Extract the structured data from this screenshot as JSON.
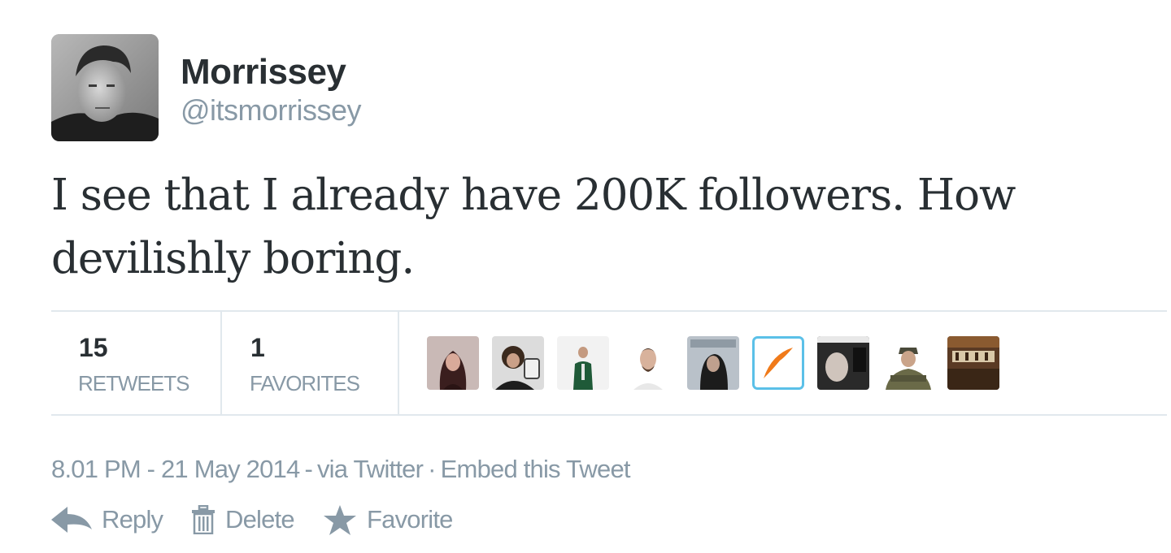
{
  "author": {
    "display_name": "Morrissey",
    "screen_name": "@itsmorrissey"
  },
  "tweet": {
    "text": "I see that I already have 200K followers. How devilishly boring."
  },
  "stats": {
    "retweets": {
      "count": "15",
      "label": "RETWEETS"
    },
    "favorites": {
      "count": "1",
      "label": "FAVORITES"
    }
  },
  "meta": {
    "timestamp": "8.01 PM - 21 May 2014",
    "dash": "-",
    "via": "via Twitter",
    "dot": "·",
    "embed": "Embed this Tweet"
  },
  "actions": {
    "reply": "Reply",
    "delete": "Delete",
    "favorite": "Favorite"
  },
  "colors": {
    "text": "#292f33",
    "muted": "#8899a6",
    "divider": "#e1e8ed"
  },
  "icons": {
    "reply": "reply-arrow-icon",
    "delete": "trash-icon",
    "favorite": "star-icon"
  }
}
